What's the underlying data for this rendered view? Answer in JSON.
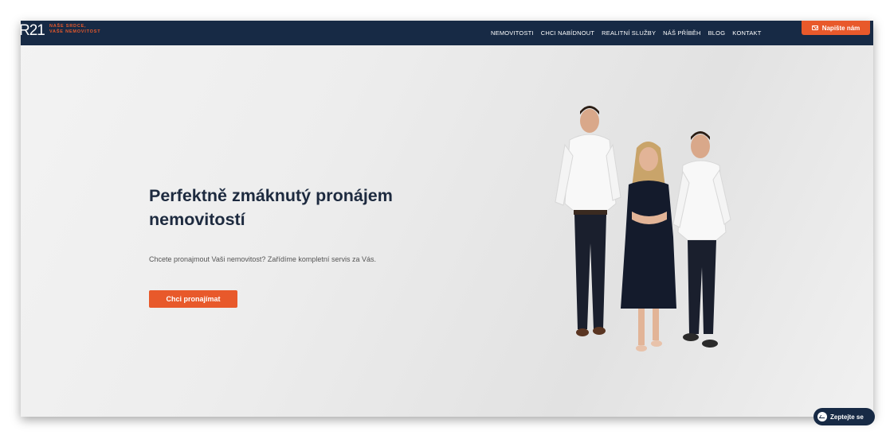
{
  "brand": {
    "logo_text": "R21",
    "tagline_line1": "NAŠE SRDCE,",
    "tagline_line2": "VAŠE NEMOVITOST"
  },
  "nav": {
    "items": [
      {
        "label": "NEMOVITOSTI"
      },
      {
        "label": "CHCI NABÍDNOUT"
      },
      {
        "label": "REALITNÍ SLUŽBY"
      },
      {
        "label": "NÁŠ PŘÍBĚH"
      },
      {
        "label": "BLOG"
      },
      {
        "label": "KONTAKT"
      }
    ],
    "contact_button": "Napište nám"
  },
  "hero": {
    "title": "Perfektně zmáknutý pronájem nemovitostí",
    "subtitle": "Chcete pronajmout Vaši nemovitost? Zařídíme kompletní servis za Vás.",
    "cta": "Chci pronajímat"
  },
  "chat": {
    "label": "Zeptejte se"
  },
  "colors": {
    "navy": "#172a45",
    "accent_orange": "#e8592b",
    "title_text": "#1d2a3f"
  },
  "icons": {
    "contact": "mail-icon",
    "chat": "messenger-icon"
  }
}
